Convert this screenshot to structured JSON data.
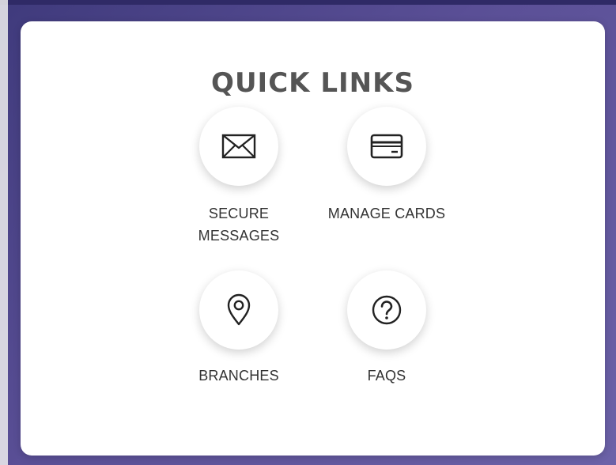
{
  "quick_links": {
    "title": "QUICK LINKS",
    "items": [
      {
        "label_line1": "SECURE",
        "label_line2": "MESSAGES",
        "icon": "envelope-icon"
      },
      {
        "label_line1": "MANAGE CARDS",
        "label_line2": "",
        "icon": "credit-card-icon"
      },
      {
        "label_line1": "BRANCHES",
        "label_line2": "",
        "icon": "location-pin-icon"
      },
      {
        "label_line1": "FAQS",
        "label_line2": "",
        "icon": "question-mark-icon"
      }
    ]
  }
}
